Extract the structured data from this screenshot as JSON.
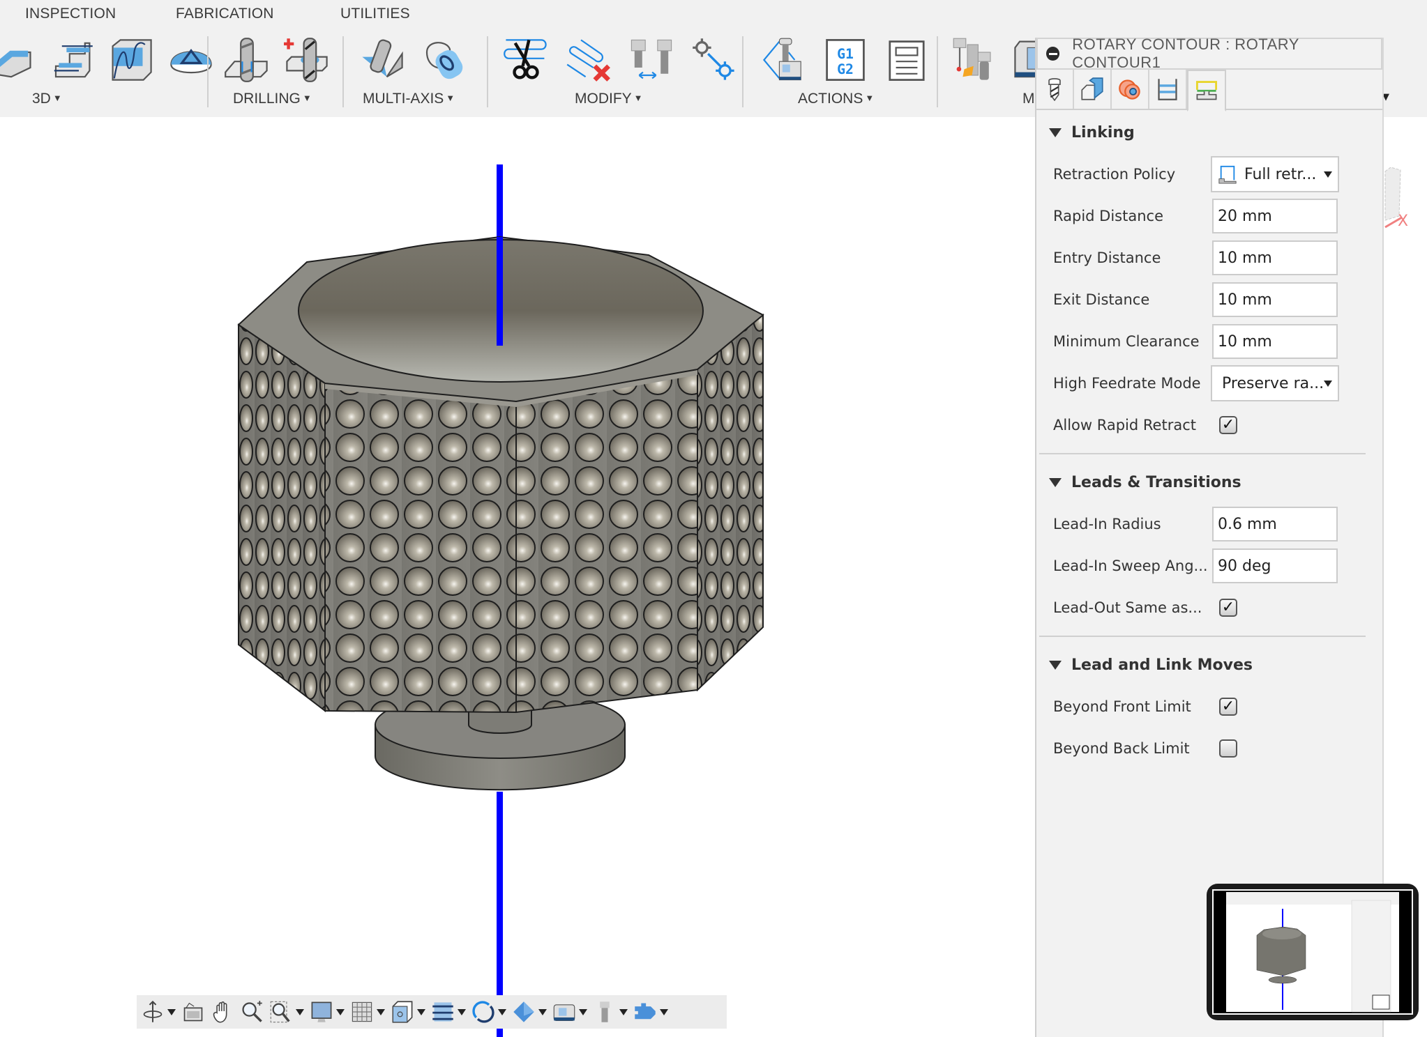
{
  "ribbon": {
    "tabs": [
      {
        "label": "INSPECTION"
      },
      {
        "label": "FABRICATION"
      },
      {
        "label": "UTILITIES"
      }
    ],
    "groups": [
      {
        "label": "3D",
        "has_dropdown": true,
        "icons": [
          "3d-steep-shallow-icon",
          "3d-horizontal-icon",
          "3d-scallop-icon",
          "3d-spiral-icon"
        ]
      },
      {
        "label": "DRILLING",
        "has_dropdown": true,
        "icons": [
          "drill-icon",
          "hole-recognition-icon"
        ]
      },
      {
        "label": "MULTI-AXIS",
        "has_dropdown": true,
        "icons": [
          "swarf-icon",
          "rotary-icon"
        ]
      },
      {
        "label": "MODIFY",
        "has_dropdown": true,
        "icons": [
          "trim-toolpath-icon",
          "delete-toolpath-icon",
          "tool-compare-icon",
          "move-point-icon"
        ]
      },
      {
        "label": "ACTIONS",
        "has_dropdown": true,
        "icons": [
          "simulate-icon",
          "post-process-icon",
          "setup-sheet-icon"
        ]
      },
      {
        "label": "M",
        "has_dropdown": false,
        "icons": [
          "tool-library-icon",
          "machine-library-icon"
        ]
      }
    ]
  },
  "panel": {
    "title": "ROTARY CONTOUR : ROTARY CONTOUR1",
    "tabs": [
      {
        "name": "tool",
        "active": false
      },
      {
        "name": "geometry",
        "active": false
      },
      {
        "name": "heights",
        "active": false
      },
      {
        "name": "passes",
        "active": false
      },
      {
        "name": "linking",
        "active": true
      }
    ],
    "sections": {
      "linking": {
        "title": "Linking",
        "retraction_policy": {
          "label": "Retraction Policy",
          "value": "Full retr..."
        },
        "rapid_distance": {
          "label": "Rapid Distance",
          "value": "20 mm"
        },
        "entry_distance": {
          "label": "Entry Distance",
          "value": "10 mm"
        },
        "exit_distance": {
          "label": "Exit Distance",
          "value": "10 mm"
        },
        "minimum_clearance": {
          "label": "Minimum Clearance",
          "value": "10 mm"
        },
        "high_feedrate_mode": {
          "label": "High Feedrate Mode",
          "value": "Preserve ra..."
        },
        "allow_rapid_retract": {
          "label": "Allow Rapid Retract",
          "checked": true
        }
      },
      "leads": {
        "title": "Leads & Transitions",
        "lead_in_radius": {
          "label": "Lead-In Radius",
          "value": "0.6 mm"
        },
        "lead_in_sweep": {
          "label": "Lead-In Sweep Ang...",
          "value": "90 deg"
        },
        "lead_out_same": {
          "label": "Lead-Out Same as...",
          "checked": true
        }
      },
      "moves": {
        "title": "Lead and Link Moves",
        "beyond_front": {
          "label": "Beyond Front Limit",
          "checked": true
        },
        "beyond_back": {
          "label": "Beyond Back Limit",
          "checked": false
        }
      }
    }
  },
  "navbar": {
    "items": [
      "orbit-icon",
      "look-at-icon",
      "pan-icon",
      "zoom-icon",
      "zoom-window-icon",
      "display-settings-icon",
      "grid-icon",
      "view-cube-icon",
      "toolpath-display-icon",
      "rotate-icon",
      "stock-icon",
      "machine-icon",
      "tool-icon",
      "plugin-icon"
    ]
  },
  "viewcube": {
    "axis_label": "X"
  },
  "colors": {
    "axis": "#0000ff",
    "part": "#7d7c74",
    "accent": "#1e88e5"
  },
  "checkmark": "✓"
}
